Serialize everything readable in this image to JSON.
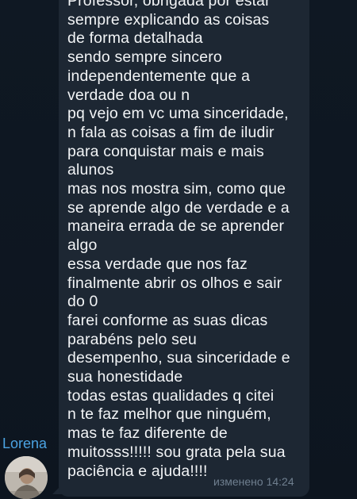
{
  "message": {
    "sender": "Lorena",
    "lines": [
      "Professor, obrigada por estar",
      "sempre explicando as coisas",
      "de forma detalhada",
      "sendo sempre sincero",
      "independentemente que a",
      "verdade doa ou n",
      "pq vejo em vc uma sinceridade,",
      "n fala as coisas a fim de iludir",
      "para conquistar mais e mais",
      "alunos",
      "mas nos mostra sim, como que",
      "se aprende algo de verdade e a",
      "maneira errada de se aprender",
      "algo",
      "essa verdade que nos faz",
      "finalmente abrir os olhos e sair",
      "do 0",
      "farei conforme as suas dicas",
      "parabéns pelo seu",
      "desempenho, sua sinceridade e",
      "sua honestidade",
      "todas estas qualidades q citei",
      "n te faz melhor que ninguém,",
      "mas te faz diferente de",
      "muitosss!!!!! sou grata pela sua",
      "paciência e ajuda!!!!"
    ],
    "edited_label": "изменено",
    "time": "14:24"
  }
}
